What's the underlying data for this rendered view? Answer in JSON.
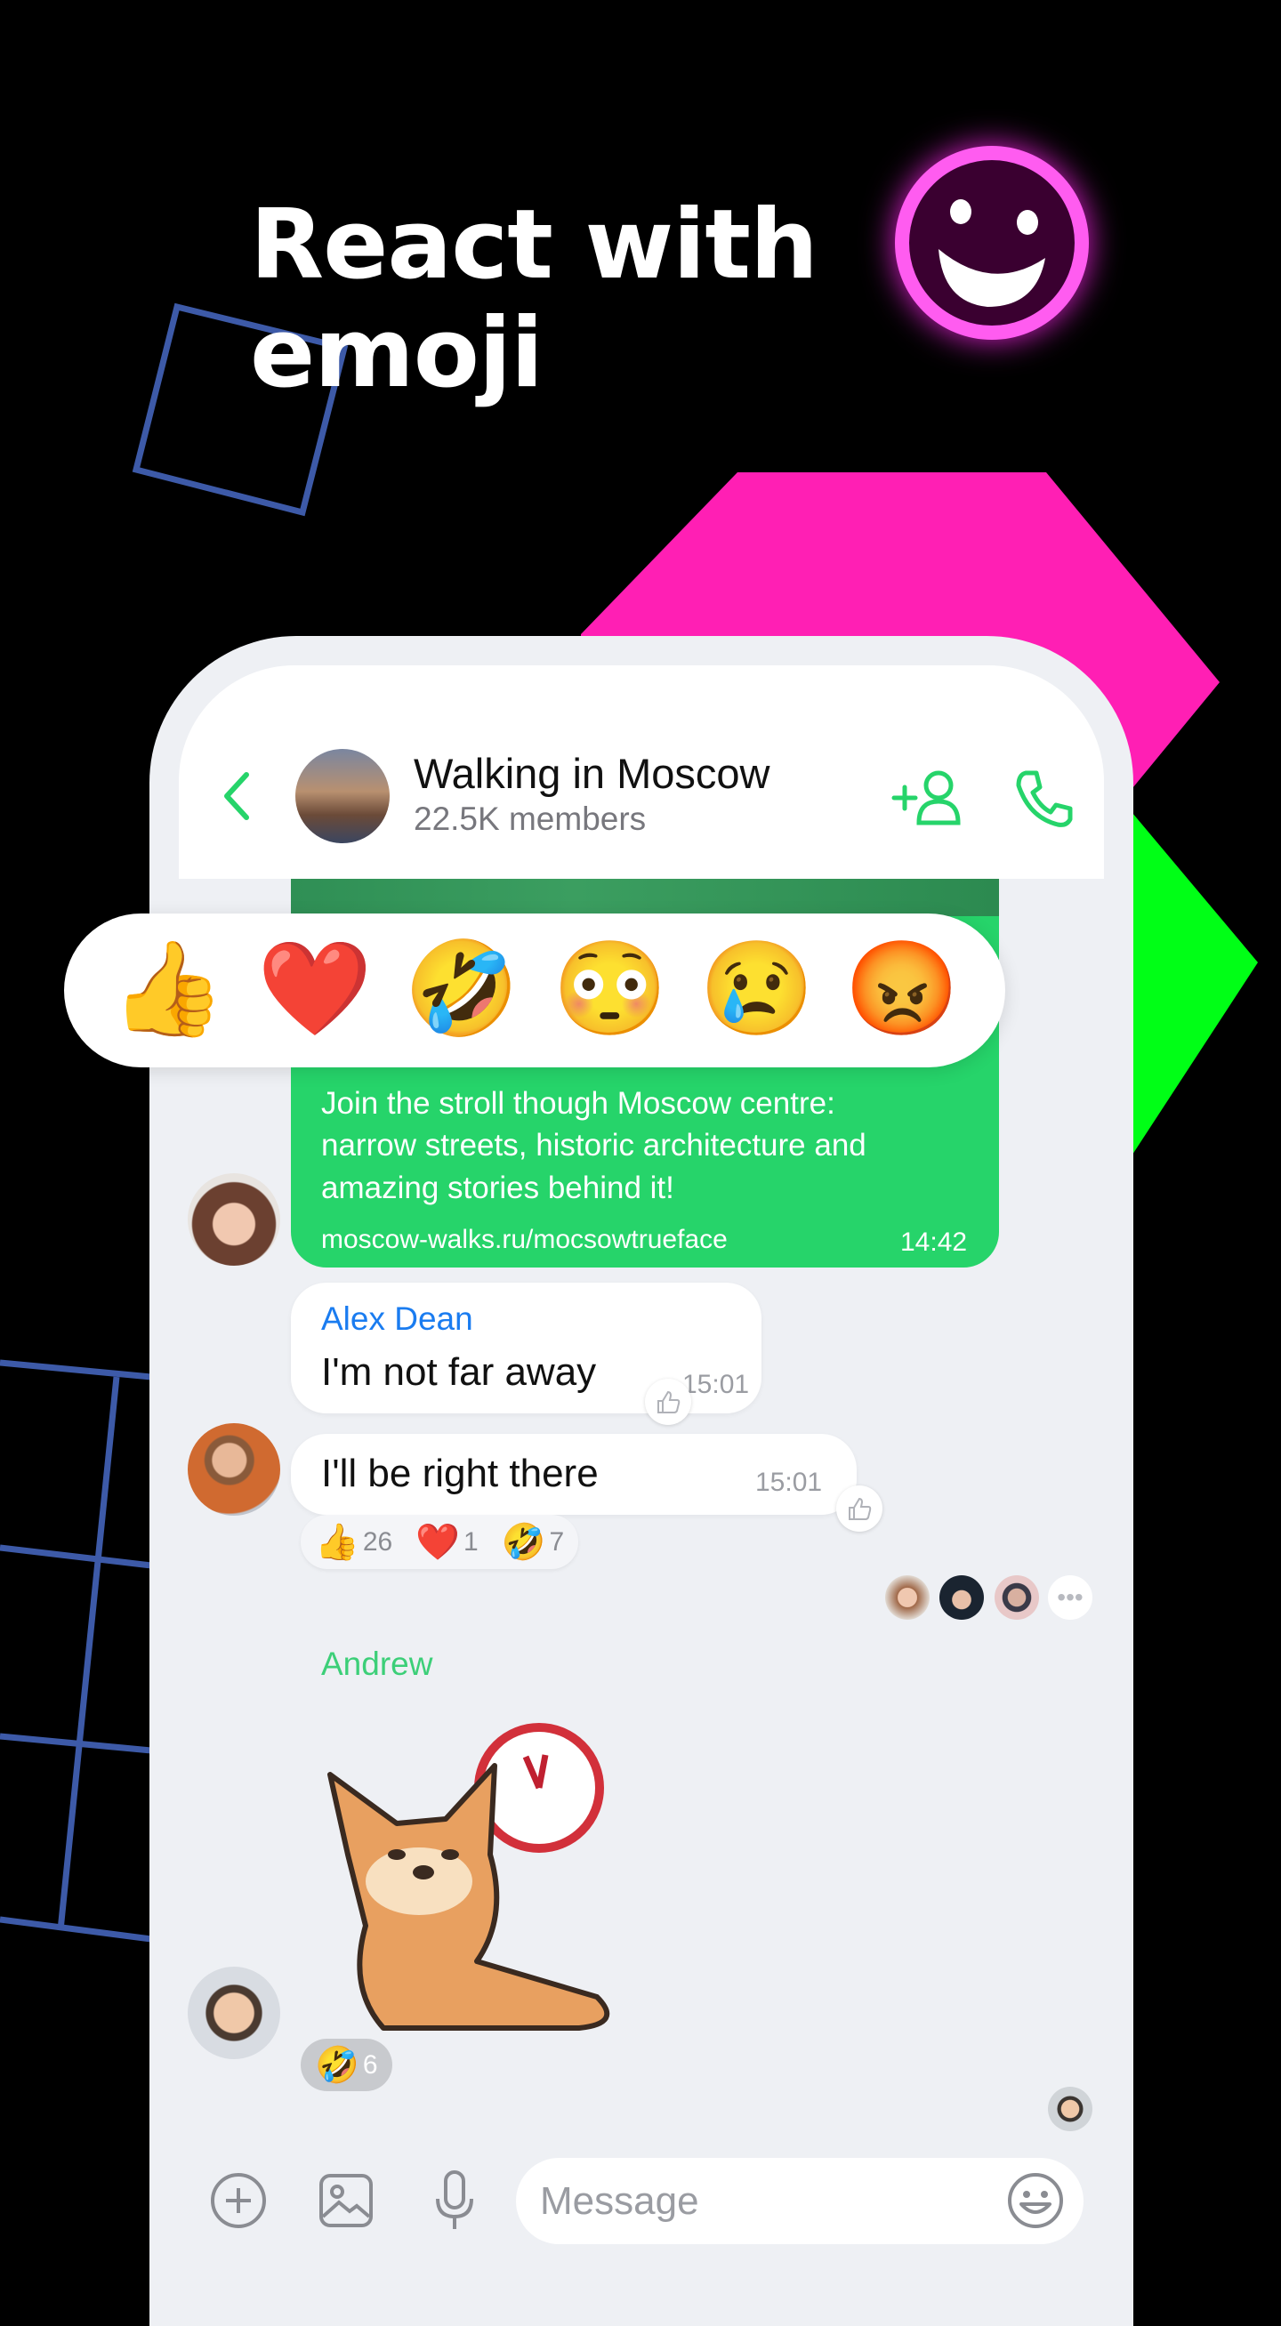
{
  "promo": {
    "headline_line1": "React with",
    "headline_line2": "emoji"
  },
  "colors": {
    "accent_green": "#26d46a",
    "name_blue": "#1a7cf0",
    "andrew_green": "#3ccf78",
    "pink": "#ff1fb4",
    "neon_green": "#00ff16",
    "outline_blue": "#3d5aa8"
  },
  "header": {
    "title": "Walking in Moscow",
    "subtitle": "22.5K members",
    "icons": [
      "back-chevron-icon",
      "add-member-icon",
      "phone-icon"
    ]
  },
  "emoji_picker": [
    "👍",
    "❤️",
    "🤣",
    "😳",
    "😢",
    "😡"
  ],
  "messages": [
    {
      "type": "post",
      "lines": [
        "Join the stroll though Moscow centre:",
        "narrow streets, historic architecture and",
        "amazing stories behind it!"
      ],
      "link": "moscow-walks.ru/mocsowtrueface",
      "time": "14:42"
    },
    {
      "sender": "Alex Dean",
      "text": "I'm not far away",
      "time": "15:01"
    },
    {
      "text": "I'll be right there",
      "time": "15:01",
      "reactions": [
        {
          "emoji": "👍",
          "count": "26"
        },
        {
          "emoji": "❤️",
          "count": "1"
        },
        {
          "emoji": "🤣",
          "count": "7"
        }
      ]
    },
    {
      "sender": "Andrew",
      "type": "sticker",
      "reactions": [
        {
          "emoji": "🤣",
          "count": "6"
        }
      ]
    }
  ],
  "composer": {
    "placeholder": "Message",
    "icons": [
      "plus-icon",
      "image-icon",
      "mic-icon",
      "emoji-icon"
    ]
  }
}
